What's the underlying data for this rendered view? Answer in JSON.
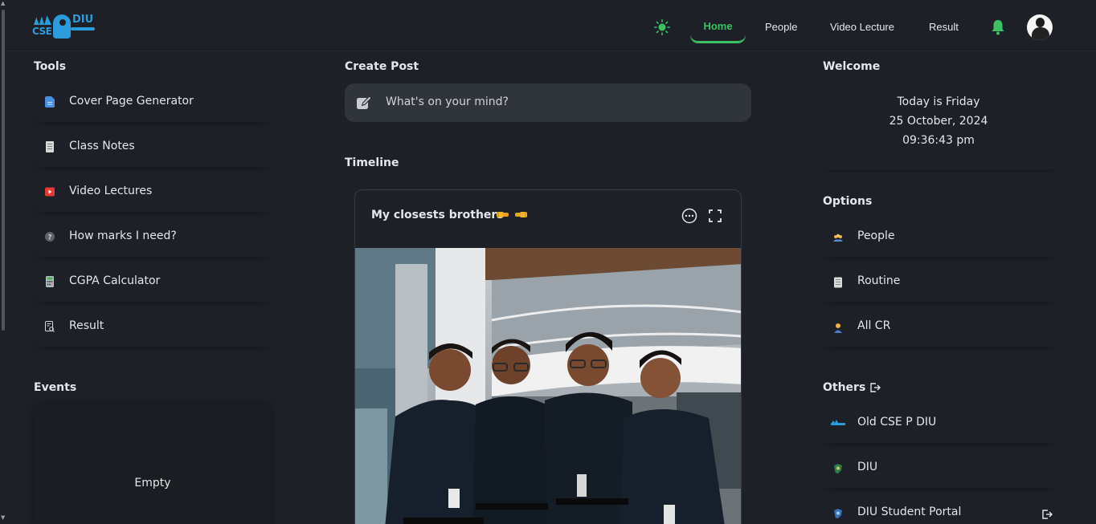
{
  "header": {
    "logo": {
      "left_text": "CSE",
      "right_text": "DIU"
    },
    "nav": {
      "home": "Home",
      "people": "People",
      "video_lecture": "Video Lecture",
      "result": "Result"
    },
    "accent_color": "#3cc062"
  },
  "left": {
    "tools_title": "Tools",
    "tools": [
      {
        "label": "Cover Page Generator",
        "icon": "document-icon",
        "color": "#4a90e2"
      },
      {
        "label": "Class Notes",
        "icon": "notes-icon",
        "color": "#d9d9d9"
      },
      {
        "label": "Video Lectures",
        "icon": "youtube-icon",
        "color": "#e53935"
      },
      {
        "label": "How marks I need?",
        "icon": "question-icon",
        "color": "#9e9e9e"
      },
      {
        "label": "CGPA Calculator",
        "icon": "calculator-icon",
        "color": "#b0bec5"
      },
      {
        "label": "Result",
        "icon": "result-icon",
        "color": "#cfd8dc"
      }
    ],
    "events_title": "Events",
    "events_empty": "Empty"
  },
  "center": {
    "create_post_title": "Create Post",
    "create_post_placeholder": "What's on your mind?",
    "timeline_title": "Timeline",
    "post": {
      "title": "My closests brothers"
    }
  },
  "right": {
    "welcome_title": "Welcome",
    "welcome_day": "Today is Friday",
    "welcome_date": "25 October, 2024",
    "welcome_time": "09:36:43 pm",
    "options_title": "Options",
    "options": [
      {
        "label": "People",
        "icon": "people-icon"
      },
      {
        "label": "Routine",
        "icon": "routine-icon"
      },
      {
        "label": "All CR",
        "icon": "cr-icon"
      }
    ],
    "others_title": "Others",
    "others": [
      {
        "label": "Old CSE P DIU",
        "icon": "old-logo-icon"
      },
      {
        "label": "DIU",
        "icon": "diu-logo-icon"
      },
      {
        "label": "DIU Student Portal",
        "icon": "portal-icon"
      }
    ]
  }
}
